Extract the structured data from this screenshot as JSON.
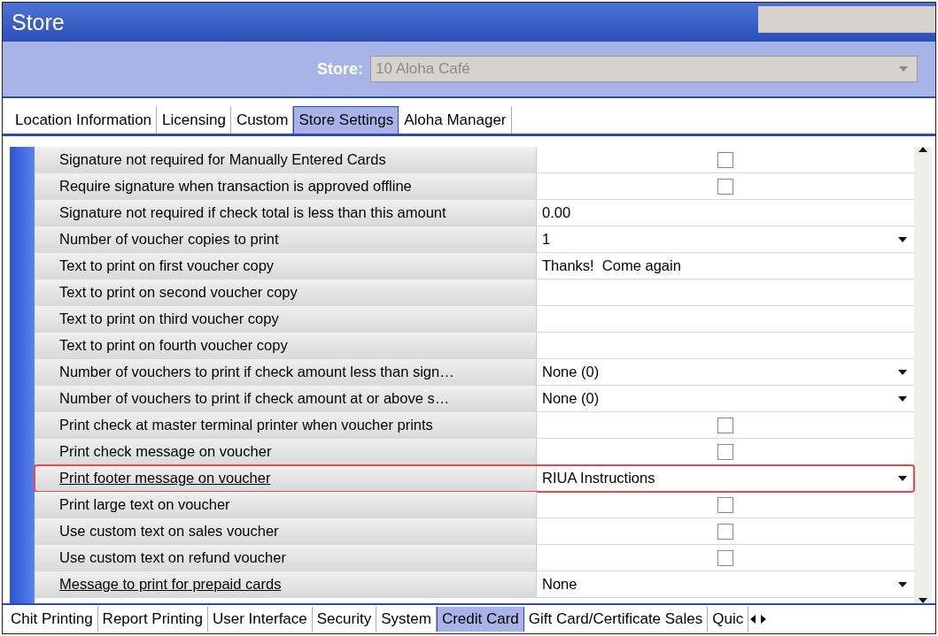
{
  "window": {
    "title": "Store"
  },
  "store_selector": {
    "label": "Store:",
    "value": "10 Aloha Café",
    "disabled": true
  },
  "tabs": [
    {
      "label": "Location Information",
      "selected": false
    },
    {
      "label": "Licensing",
      "selected": false
    },
    {
      "label": "Custom",
      "selected": false
    },
    {
      "label": "Store Settings",
      "selected": true
    },
    {
      "label": "Aloha Manager",
      "selected": false
    }
  ],
  "settings": [
    {
      "label": "Signature not required for Manually Entered Cards",
      "kind": "checkbox",
      "checked": false,
      "underlined": false,
      "highlighted": false
    },
    {
      "label": "Require signature when transaction is approved offline",
      "kind": "checkbox",
      "checked": false,
      "underlined": false,
      "highlighted": false
    },
    {
      "label": "Signature not required if check total is less than this amount",
      "kind": "text",
      "value": "0.00",
      "underlined": false,
      "highlighted": false
    },
    {
      "label": "Number of voucher copies to print",
      "kind": "dropdown",
      "value": "1",
      "underlined": false,
      "highlighted": false
    },
    {
      "label": "Text to print on first voucher copy",
      "kind": "text",
      "value": "Thanks!  Come again",
      "underlined": false,
      "highlighted": false
    },
    {
      "label": "Text to print on second voucher copy",
      "kind": "text",
      "underlined": false,
      "highlighted": false
    },
    {
      "label": "Text to print on third voucher copy",
      "kind": "text",
      "underlined": false,
      "highlighted": false
    },
    {
      "label": "Text to print on fourth voucher copy",
      "kind": "text",
      "underlined": false,
      "highlighted": false
    },
    {
      "label": "Number of vouchers to print if check amount less than sign…",
      "kind": "dropdown",
      "value": "None (0)",
      "underlined": false,
      "highlighted": false
    },
    {
      "label": "Number of vouchers to print if check amount at or above s…",
      "kind": "dropdown",
      "value": "None (0)",
      "underlined": false,
      "highlighted": false
    },
    {
      "label": "Print check at master terminal printer when voucher prints",
      "kind": "checkbox",
      "checked": false,
      "underlined": false,
      "highlighted": false
    },
    {
      "label": "Print check message on voucher",
      "kind": "checkbox",
      "checked": false,
      "underlined": false,
      "highlighted": false
    },
    {
      "label": "Print footer message on voucher",
      "kind": "dropdown",
      "value": "RIUA Instructions",
      "underlined": true,
      "highlighted": true
    },
    {
      "label": "Print large text on voucher",
      "kind": "checkbox",
      "checked": false,
      "underlined": false,
      "highlighted": false
    },
    {
      "label": "Use custom text on sales voucher",
      "kind": "checkbox",
      "checked": false,
      "underlined": false,
      "highlighted": false
    },
    {
      "label": "Use custom text on refund voucher",
      "kind": "checkbox",
      "checked": false,
      "underlined": false,
      "highlighted": false
    },
    {
      "label": "Message to print for prepaid cards",
      "kind": "dropdown",
      "value": "None",
      "underlined": true,
      "highlighted": false
    }
  ],
  "bottom_tabs": [
    {
      "label": "Chit Printing",
      "selected": false
    },
    {
      "label": "Report Printing",
      "selected": false
    },
    {
      "label": "User Interface",
      "selected": false
    },
    {
      "label": "Security",
      "selected": false
    },
    {
      "label": "System",
      "selected": false
    },
    {
      "label": "Credit Card",
      "selected": true
    },
    {
      "label": "Gift Card/Certificate Sales",
      "selected": false
    },
    {
      "label": "Quic",
      "selected": false
    }
  ]
}
